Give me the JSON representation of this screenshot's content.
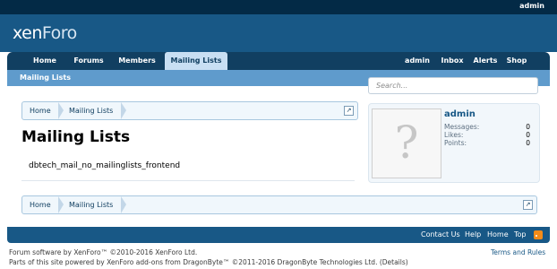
{
  "topbar": {
    "user": "admin"
  },
  "header": {
    "logo_a": "xen",
    "logo_b": "Foro"
  },
  "nav": {
    "tabs": [
      "Home",
      "Forums",
      "Members",
      "Mailing Lists"
    ],
    "right": [
      "admin",
      "Inbox",
      "Alerts",
      "Shop"
    ]
  },
  "subnav": {
    "link": "Mailing Lists"
  },
  "search": {
    "placeholder": "Search..."
  },
  "breadcrumb": {
    "items": [
      "Home",
      "Mailing Lists"
    ]
  },
  "page": {
    "title": "Mailing Lists",
    "message": "dbtech_mail_no_mailinglists_frontend"
  },
  "sidebar": {
    "username": "admin",
    "stats": [
      {
        "label": "Messages:",
        "value": "0"
      },
      {
        "label": "Likes:",
        "value": "0"
      },
      {
        "label": "Points:",
        "value": "0"
      }
    ]
  },
  "footer": {
    "links": [
      "Contact Us",
      "Help",
      "Home",
      "Top"
    ]
  },
  "copyright": {
    "line1": "Forum software by XenForo™ ©2010-2016 XenForo Ltd.",
    "line2": "Parts of this site powered by XenForo add-ons from DragonByte™ ©2011-2016 DragonByte Technologies Ltd. (Details)",
    "terms": "Terms and Rules"
  },
  "colors": {
    "header": "#185886",
    "topbar": "#032a46",
    "nav": "#113f61",
    "accent": "#5f9bcc"
  },
  "icons": [
    "question-avatar-icon",
    "jump-icon",
    "rss-icon"
  ]
}
